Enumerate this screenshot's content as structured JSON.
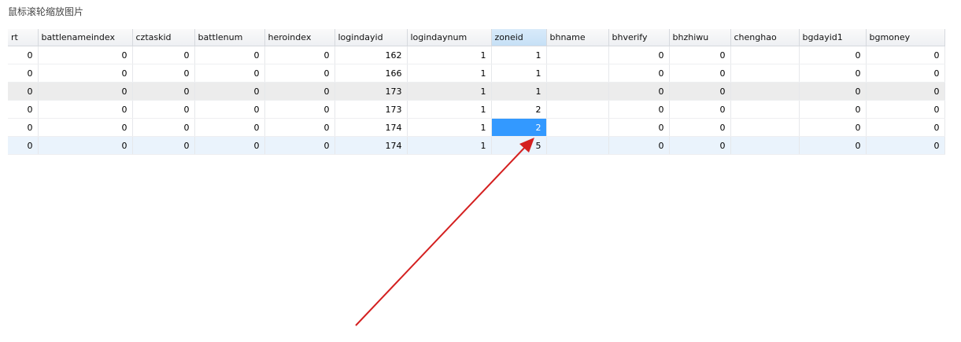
{
  "caption": "鼠标滚轮缩放图片",
  "table": {
    "columns": [
      "rt",
      "battlenameindex",
      "cztaskid",
      "battlenum",
      "heroindex",
      "logindayid",
      "logindaynum",
      "zoneid",
      "bhname",
      "bhverify",
      "bhzhiwu",
      "chenghao",
      "bgdayid1",
      "bgmoney"
    ],
    "rows": [
      [
        "0",
        "0",
        "0",
        "0",
        "0",
        "162",
        "1",
        "1",
        "",
        "0",
        "0",
        "",
        "0",
        "0"
      ],
      [
        "0",
        "0",
        "0",
        "0",
        "0",
        "166",
        "1",
        "1",
        "",
        "0",
        "0",
        "",
        "0",
        "0"
      ],
      [
        "0",
        "0",
        "0",
        "0",
        "0",
        "173",
        "1",
        "1",
        "",
        "0",
        "0",
        "",
        "0",
        "0"
      ],
      [
        "0",
        "0",
        "0",
        "0",
        "0",
        "173",
        "1",
        "2",
        "",
        "0",
        "0",
        "",
        "0",
        "0"
      ],
      [
        "0",
        "0",
        "0",
        "0",
        "0",
        "174",
        "1",
        "2",
        "",
        "0",
        "0",
        "",
        "0",
        "0"
      ],
      [
        "0",
        "0",
        "0",
        "0",
        "0",
        "174",
        "1",
        "5",
        "",
        "0",
        "0",
        "",
        "0",
        "0"
      ]
    ]
  },
  "colors": {
    "selected_cell": "#3399ff",
    "arrow": "#d42020"
  }
}
